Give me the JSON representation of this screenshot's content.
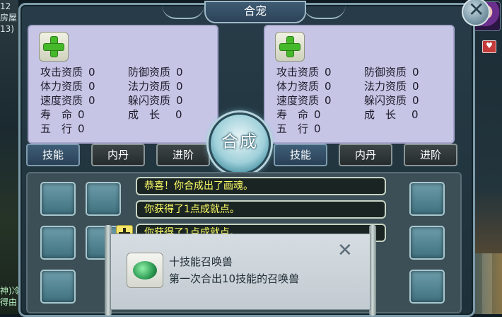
{
  "window": {
    "title": "合宠"
  },
  "left_panel": {
    "stats": [
      {
        "label": "攻击资质",
        "value": "0"
      },
      {
        "label": "防御资质",
        "value": "0"
      },
      {
        "label": "体力资质",
        "value": "0"
      },
      {
        "label": "法力资质",
        "value": "0"
      },
      {
        "label": "速度资质",
        "value": "0"
      },
      {
        "label": "躲闪资质",
        "value": "0"
      },
      {
        "label": "寿　命",
        "value": "0"
      },
      {
        "label": "成　长",
        "value": "0"
      },
      {
        "label": "五　行",
        "value": "0"
      }
    ]
  },
  "right_panel": {
    "stats": [
      {
        "label": "攻击资质",
        "value": "0"
      },
      {
        "label": "防御资质",
        "value": "0"
      },
      {
        "label": "体力资质",
        "value": "0"
      },
      {
        "label": "法力资质",
        "value": "0"
      },
      {
        "label": "速度资质",
        "value": "0"
      },
      {
        "label": "躲闪资质",
        "value": "0"
      },
      {
        "label": "寿　命",
        "value": "0"
      },
      {
        "label": "成　长",
        "value": "0"
      },
      {
        "label": "五　行",
        "value": "0"
      }
    ]
  },
  "tabs_left": [
    "技能",
    "内丹",
    "进阶"
  ],
  "tabs_right": [
    "技能",
    "内丹",
    "进阶"
  ],
  "combine_label": "合成",
  "messages": [
    "恭喜！你合成出了画魂。",
    "你获得了1点成就点。",
    "你获得了1点成就点。"
  ],
  "achievement": {
    "title": "十技能召唤兽",
    "description": "第一次合出10技能的召唤兽"
  },
  "background": {
    "left_texts": [
      "12",
      "房屋",
      "13)",
      "神)冷",
      "得由"
    ]
  },
  "colors": {
    "accent_panel": "#c7c5e5",
    "message_text": "#ffff66"
  }
}
